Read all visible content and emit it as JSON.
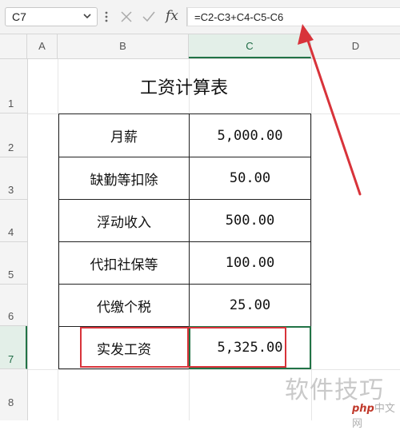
{
  "formula_bar": {
    "name_box": "C7",
    "fx_label": "fx",
    "formula": "=C2-C3+C4-C5-C6"
  },
  "columns": [
    "A",
    "B",
    "C",
    "D"
  ],
  "selected_column": "C",
  "rows": [
    "1",
    "2",
    "3",
    "4",
    "5",
    "6",
    "7",
    "8"
  ],
  "selected_row": "7",
  "sheet": {
    "title": "工资计算表",
    "items": [
      {
        "label": "月薪",
        "value": "5,000.00"
      },
      {
        "label": "缺勤等扣除",
        "value": "50.00"
      },
      {
        "label": "浮动收入",
        "value": "500.00"
      },
      {
        "label": "代扣社保等",
        "value": "100.00"
      },
      {
        "label": "代缴个税",
        "value": "25.00"
      },
      {
        "label": "实发工资",
        "value": "5,325.00"
      }
    ]
  },
  "watermark": {
    "text": "软件技巧",
    "logo_php": "php",
    "logo_rest": "中文网"
  },
  "colors": {
    "accent_green": "#217346",
    "highlight_red": "#d8333a"
  }
}
